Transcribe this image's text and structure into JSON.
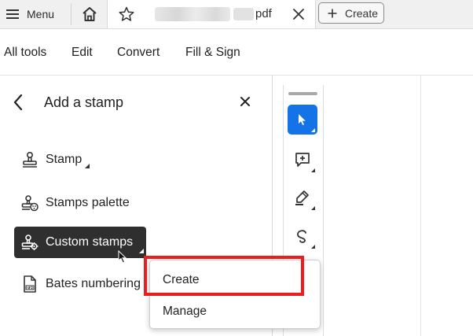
{
  "tabbar": {
    "menu_label": "Menu",
    "tab_filename_suffix": "pdf",
    "create_label": "Create"
  },
  "menubar": {
    "items": [
      "All tools",
      "Edit",
      "Convert",
      "Fill & Sign"
    ]
  },
  "panel": {
    "title": "Add a stamp",
    "tools": [
      {
        "label": "Stamp",
        "icon": "stamp-icon",
        "has_caret": true,
        "selected": false
      },
      {
        "label": "Stamps palette",
        "icon": "stamps-palette-icon",
        "has_caret": false,
        "selected": false
      },
      {
        "label": "Custom stamps",
        "icon": "custom-stamps-icon",
        "has_caret": true,
        "selected": true
      },
      {
        "label": "Bates numbering",
        "icon": "bates-numbering-icon",
        "has_caret": false,
        "selected": false
      }
    ]
  },
  "toolstrip": {
    "tools": [
      "select-pointer-icon",
      "add-comment-icon",
      "highlight-pen-icon",
      "draw-freeform-icon"
    ],
    "active_color": "#1473e6"
  },
  "context_menu": {
    "items": [
      "Create",
      "Manage"
    ],
    "highlight_color": "#ee1d1d"
  }
}
